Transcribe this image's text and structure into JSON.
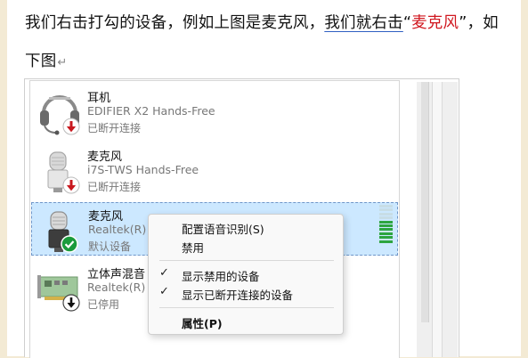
{
  "document": {
    "line1_a": "我们右击打勾的设备，例如上图是麦克风，",
    "line1_b": "我们就右击",
    "line1_c": "“",
    "line1_d": "麦克风",
    "line1_e": "”，如",
    "line2": "下图",
    "para_mark": "↵"
  },
  "devices": [
    {
      "name": "耳机",
      "model": "EDIFIER X2 Hands-Free",
      "status": "已断开连接",
      "icon": "headset-icon",
      "badge": "down-arrow-red"
    },
    {
      "name": "麦克风",
      "model": "i7S-TWS Hands-Free",
      "status": "已断开连接",
      "icon": "microphone-icon",
      "badge": "down-arrow-red"
    },
    {
      "name": "麦克风",
      "model": "Realtek(R) A",
      "status": "默认设备",
      "icon": "microphone-icon",
      "badge": "check-green",
      "selected": true,
      "level": 0.55
    },
    {
      "name": "立体声混音",
      "model": "Realtek(R) A",
      "status": "已停用",
      "icon": "sound-card-icon",
      "badge": "down-arrow-black"
    }
  ],
  "context_menu": {
    "items": [
      {
        "label": "配置语音识别(S)",
        "checked": false
      },
      {
        "label": "禁用",
        "checked": false
      },
      {
        "label": "显示禁用的设备",
        "checked": true
      },
      {
        "label": "显示已断开连接的设备",
        "checked": true
      },
      {
        "label": "属性(P)",
        "checked": false,
        "bold": true
      }
    ]
  },
  "colors": {
    "selection": "#cce8ff",
    "level_on": "#2da540",
    "badge_red": "#c8191f",
    "badge_green": "#1a9b3c",
    "link_red": "#d0171f"
  }
}
